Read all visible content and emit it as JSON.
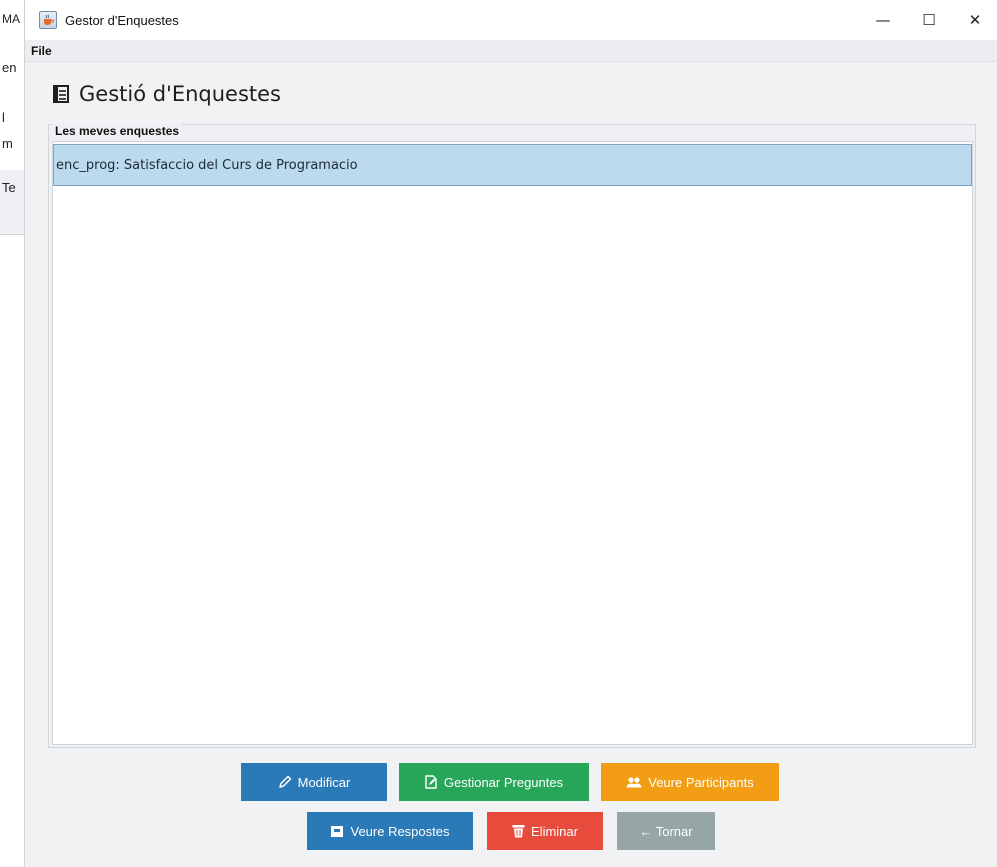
{
  "background_window": {
    "fragments": [
      "MA",
      "en",
      "l",
      "m",
      "Te"
    ]
  },
  "window": {
    "title": "Gestor d'Enquestes",
    "controls": {
      "minimize": "—",
      "maximize": "☐",
      "close": "✕"
    }
  },
  "menubar": {
    "items": [
      "File"
    ]
  },
  "page": {
    "heading": "Gestió d'Enquestes"
  },
  "surveys_panel": {
    "title": "Les meves enquestes",
    "items": [
      {
        "label": "enc_prog: Satisfaccio del Curs de Programacio",
        "selected": true
      }
    ]
  },
  "actions": {
    "modify": "Modificar",
    "manage_questions": "Gestionar Preguntes",
    "view_participants": "Veure Participants",
    "view_answers": "Veure Respostes",
    "delete": "Eliminar",
    "back": "← Tornar"
  },
  "colors": {
    "blue": "#2a7ab8",
    "green": "#27a65a",
    "orange": "#f29d13",
    "red": "#e74b3c",
    "gray": "#96a5a6",
    "selection": "#bcdaed"
  },
  "icons": {
    "app": "java-cup-icon",
    "heading": "document-icon",
    "modify": "pencil-icon",
    "manage_questions": "edit-document-icon",
    "view_participants": "users-icon",
    "view_answers": "inbox-icon",
    "delete": "trash-icon"
  }
}
